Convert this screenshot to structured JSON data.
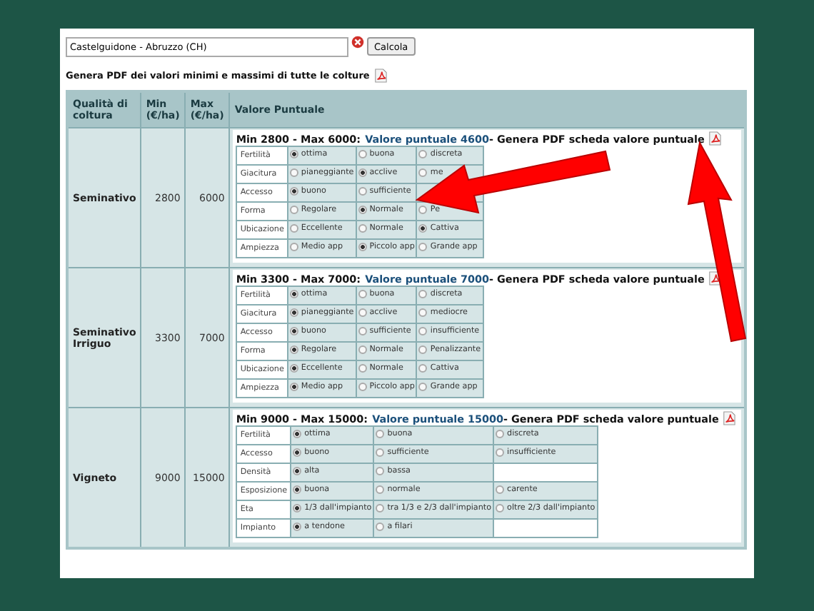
{
  "search": {
    "value": "Castelguidone - Abruzzo (CH)",
    "button": "Calcola"
  },
  "pdf_all": "Genera PDF dei valori minimi e massimi di tutte le colture",
  "table": {
    "columns": [
      "Qualità di coltura",
      "Min (€/ha)",
      "Max (€/ha)",
      "Valore Puntuale"
    ],
    "rows": [
      {
        "quality": "Seminativo",
        "min": "2800",
        "max": "6000",
        "range": "Min 2800 - Max 6000:",
        "link": "Valore puntuale 4600",
        "suffix": "- Genera PDF scheda valore puntuale",
        "criteria": [
          {
            "label": "Fertilità",
            "options": [
              {
                "label": "ottima",
                "selected": true
              },
              {
                "label": "buona",
                "selected": false
              },
              {
                "label": "discreta",
                "selected": false
              }
            ]
          },
          {
            "label": "Giacitura",
            "options": [
              {
                "label": "pianeggiante",
                "selected": false
              },
              {
                "label": "acclive",
                "selected": true
              },
              {
                "label": "me",
                "selected": false
              }
            ]
          },
          {
            "label": "Accesso",
            "options": [
              {
                "label": "buono",
                "selected": true
              },
              {
                "label": "sufficiente",
                "selected": false
              }
            ]
          },
          {
            "label": "Forma",
            "options": [
              {
                "label": "Regolare",
                "selected": false
              },
              {
                "label": "Normale",
                "selected": true
              },
              {
                "label": "Pe",
                "selected": false
              }
            ]
          },
          {
            "label": "Ubicazione",
            "options": [
              {
                "label": "Eccellente",
                "selected": false
              },
              {
                "label": "Normale",
                "selected": false
              },
              {
                "label": "Cattiva",
                "selected": true
              }
            ]
          },
          {
            "label": "Ampiezza",
            "options": [
              {
                "label": "Medio app",
                "selected": false
              },
              {
                "label": "Piccolo app",
                "selected": true
              },
              {
                "label": "Grande app",
                "selected": false
              }
            ]
          }
        ]
      },
      {
        "quality": "Seminativo Irriguo",
        "min": "3300",
        "max": "7000",
        "range": "Min 3300 - Max 7000:",
        "link": "Valore puntuale 7000",
        "suffix": "- Genera PDF scheda valore puntuale",
        "criteria": [
          {
            "label": "Fertilità",
            "options": [
              {
                "label": "ottima",
                "selected": true
              },
              {
                "label": "buona",
                "selected": false
              },
              {
                "label": "discreta",
                "selected": false
              }
            ]
          },
          {
            "label": "Giacitura",
            "options": [
              {
                "label": "pianeggiante",
                "selected": true
              },
              {
                "label": "acclive",
                "selected": false
              },
              {
                "label": "mediocre",
                "selected": false
              }
            ]
          },
          {
            "label": "Accesso",
            "options": [
              {
                "label": "buono",
                "selected": true
              },
              {
                "label": "sufficiente",
                "selected": false
              },
              {
                "label": "insufficiente",
                "selected": false
              }
            ]
          },
          {
            "label": "Forma",
            "options": [
              {
                "label": "Regolare",
                "selected": true
              },
              {
                "label": "Normale",
                "selected": false
              },
              {
                "label": "Penalizzante",
                "selected": false
              }
            ]
          },
          {
            "label": "Ubicazione",
            "options": [
              {
                "label": "Eccellente",
                "selected": true
              },
              {
                "label": "Normale",
                "selected": false
              },
              {
                "label": "Cattiva",
                "selected": false
              }
            ]
          },
          {
            "label": "Ampiezza",
            "options": [
              {
                "label": "Medio app",
                "selected": true
              },
              {
                "label": "Piccolo app",
                "selected": false
              },
              {
                "label": "Grande app",
                "selected": false
              }
            ]
          }
        ]
      },
      {
        "quality": "Vigneto",
        "min": "9000",
        "max": "15000",
        "range": "Min 9000 - Max 15000:",
        "link": "Valore puntuale 15000",
        "suffix": "- Genera PDF scheda valore puntuale",
        "criteria": [
          {
            "label": "Fertilità",
            "options": [
              {
                "label": "ottima",
                "selected": true
              },
              {
                "label": "buona",
                "selected": false
              },
              {
                "label": "discreta",
                "selected": false
              }
            ]
          },
          {
            "label": "Accesso",
            "options": [
              {
                "label": "buono",
                "selected": true
              },
              {
                "label": "sufficiente",
                "selected": false
              },
              {
                "label": "insufficiente",
                "selected": false
              }
            ]
          },
          {
            "label": "Densità",
            "options": [
              {
                "label": "alta",
                "selected": true
              },
              {
                "label": "bassa",
                "selected": false
              }
            ]
          },
          {
            "label": "Esposizione",
            "options": [
              {
                "label": "buona",
                "selected": true
              },
              {
                "label": "normale",
                "selected": false
              },
              {
                "label": "carente",
                "selected": false
              }
            ]
          },
          {
            "label": "Eta",
            "options": [
              {
                "label": "1/3 dall'impianto",
                "selected": true
              },
              {
                "label": "tra 1/3 e 2/3 dall'impianto",
                "selected": false
              },
              {
                "label": "oltre 2/3 dall'impianto",
                "selected": false
              }
            ]
          },
          {
            "label": "Impianto",
            "options": [
              {
                "label": "a tendone",
                "selected": true
              },
              {
                "label": "a filari",
                "selected": false
              }
            ]
          }
        ]
      }
    ]
  }
}
